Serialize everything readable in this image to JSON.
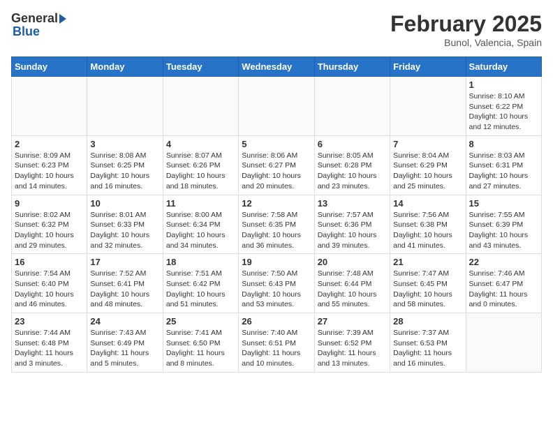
{
  "header": {
    "logo_general": "General",
    "logo_blue": "Blue",
    "month_title": "February 2025",
    "location": "Bunol, Valencia, Spain"
  },
  "weekdays": [
    "Sunday",
    "Monday",
    "Tuesday",
    "Wednesday",
    "Thursday",
    "Friday",
    "Saturday"
  ],
  "weeks": [
    [
      {
        "day": "",
        "info": ""
      },
      {
        "day": "",
        "info": ""
      },
      {
        "day": "",
        "info": ""
      },
      {
        "day": "",
        "info": ""
      },
      {
        "day": "",
        "info": ""
      },
      {
        "day": "",
        "info": ""
      },
      {
        "day": "1",
        "info": "Sunrise: 8:10 AM\nSunset: 6:22 PM\nDaylight: 10 hours\nand 12 minutes."
      }
    ],
    [
      {
        "day": "2",
        "info": "Sunrise: 8:09 AM\nSunset: 6:23 PM\nDaylight: 10 hours\nand 14 minutes."
      },
      {
        "day": "3",
        "info": "Sunrise: 8:08 AM\nSunset: 6:25 PM\nDaylight: 10 hours\nand 16 minutes."
      },
      {
        "day": "4",
        "info": "Sunrise: 8:07 AM\nSunset: 6:26 PM\nDaylight: 10 hours\nand 18 minutes."
      },
      {
        "day": "5",
        "info": "Sunrise: 8:06 AM\nSunset: 6:27 PM\nDaylight: 10 hours\nand 20 minutes."
      },
      {
        "day": "6",
        "info": "Sunrise: 8:05 AM\nSunset: 6:28 PM\nDaylight: 10 hours\nand 23 minutes."
      },
      {
        "day": "7",
        "info": "Sunrise: 8:04 AM\nSunset: 6:29 PM\nDaylight: 10 hours\nand 25 minutes."
      },
      {
        "day": "8",
        "info": "Sunrise: 8:03 AM\nSunset: 6:31 PM\nDaylight: 10 hours\nand 27 minutes."
      }
    ],
    [
      {
        "day": "9",
        "info": "Sunrise: 8:02 AM\nSunset: 6:32 PM\nDaylight: 10 hours\nand 29 minutes."
      },
      {
        "day": "10",
        "info": "Sunrise: 8:01 AM\nSunset: 6:33 PM\nDaylight: 10 hours\nand 32 minutes."
      },
      {
        "day": "11",
        "info": "Sunrise: 8:00 AM\nSunset: 6:34 PM\nDaylight: 10 hours\nand 34 minutes."
      },
      {
        "day": "12",
        "info": "Sunrise: 7:58 AM\nSunset: 6:35 PM\nDaylight: 10 hours\nand 36 minutes."
      },
      {
        "day": "13",
        "info": "Sunrise: 7:57 AM\nSunset: 6:36 PM\nDaylight: 10 hours\nand 39 minutes."
      },
      {
        "day": "14",
        "info": "Sunrise: 7:56 AM\nSunset: 6:38 PM\nDaylight: 10 hours\nand 41 minutes."
      },
      {
        "day": "15",
        "info": "Sunrise: 7:55 AM\nSunset: 6:39 PM\nDaylight: 10 hours\nand 43 minutes."
      }
    ],
    [
      {
        "day": "16",
        "info": "Sunrise: 7:54 AM\nSunset: 6:40 PM\nDaylight: 10 hours\nand 46 minutes."
      },
      {
        "day": "17",
        "info": "Sunrise: 7:52 AM\nSunset: 6:41 PM\nDaylight: 10 hours\nand 48 minutes."
      },
      {
        "day": "18",
        "info": "Sunrise: 7:51 AM\nSunset: 6:42 PM\nDaylight: 10 hours\nand 51 minutes."
      },
      {
        "day": "19",
        "info": "Sunrise: 7:50 AM\nSunset: 6:43 PM\nDaylight: 10 hours\nand 53 minutes."
      },
      {
        "day": "20",
        "info": "Sunrise: 7:48 AM\nSunset: 6:44 PM\nDaylight: 10 hours\nand 55 minutes."
      },
      {
        "day": "21",
        "info": "Sunrise: 7:47 AM\nSunset: 6:45 PM\nDaylight: 10 hours\nand 58 minutes."
      },
      {
        "day": "22",
        "info": "Sunrise: 7:46 AM\nSunset: 6:47 PM\nDaylight: 11 hours\nand 0 minutes."
      }
    ],
    [
      {
        "day": "23",
        "info": "Sunrise: 7:44 AM\nSunset: 6:48 PM\nDaylight: 11 hours\nand 3 minutes."
      },
      {
        "day": "24",
        "info": "Sunrise: 7:43 AM\nSunset: 6:49 PM\nDaylight: 11 hours\nand 5 minutes."
      },
      {
        "day": "25",
        "info": "Sunrise: 7:41 AM\nSunset: 6:50 PM\nDaylight: 11 hours\nand 8 minutes."
      },
      {
        "day": "26",
        "info": "Sunrise: 7:40 AM\nSunset: 6:51 PM\nDaylight: 11 hours\nand 10 minutes."
      },
      {
        "day": "27",
        "info": "Sunrise: 7:39 AM\nSunset: 6:52 PM\nDaylight: 11 hours\nand 13 minutes."
      },
      {
        "day": "28",
        "info": "Sunrise: 7:37 AM\nSunset: 6:53 PM\nDaylight: 11 hours\nand 16 minutes."
      },
      {
        "day": "",
        "info": ""
      }
    ]
  ]
}
